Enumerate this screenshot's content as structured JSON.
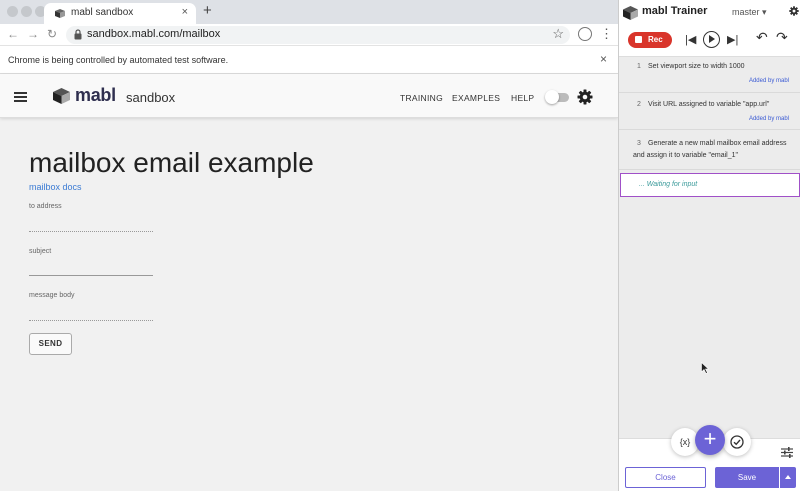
{
  "browser": {
    "tab_title": "mabl sandbox",
    "new_tab": "+",
    "tab_close": "×",
    "url": "sandbox.mabl.com/mailbox",
    "back": "←",
    "forward": "→",
    "reload": "↻",
    "star": "☆",
    "menu": "⋮",
    "automation_notice": "Chrome is being controlled by automated test software.",
    "notice_close": "×"
  },
  "app": {
    "brand": "mabl",
    "brand_sub": "sandbox",
    "nav": [
      "TRAINING",
      "EXAMPLES",
      "HELP"
    ],
    "toggle_on": false
  },
  "page": {
    "heading": "mailbox email example",
    "docs_link": "mailbox docs",
    "fields": [
      {
        "label": "to address",
        "value": ""
      },
      {
        "label": "subject",
        "value": ""
      },
      {
        "label": "message body",
        "value": ""
      }
    ],
    "send_label": "SEND"
  },
  "trainer": {
    "title": "mabl Trainer",
    "branch": "master ▾",
    "rec_label": "Rec",
    "controls": {
      "first": "|◀",
      "last": "▶|",
      "undo": "↶",
      "redo": "↷"
    },
    "steps": [
      {
        "num": "1",
        "text": "Set viewport size to width 1000",
        "added_by": "Added by mabl"
      },
      {
        "num": "2",
        "text": "Visit URL assigned to variable \"app.url\"",
        "added_by": "Added by mabl"
      },
      {
        "num": "3",
        "text": "Generate a new mabl mailbox email address and assign it to variable \"email_1\"",
        "added_by": ""
      }
    ],
    "waiting": "... Waiting for input",
    "var_label": "{x}",
    "add_label": "+",
    "close_label": "Close",
    "save_label": "Save"
  },
  "colors": {
    "accent": "#6c63d6",
    "record": "#d9352b",
    "link": "#3b7bd4",
    "waiting_border": "#a050c8"
  }
}
